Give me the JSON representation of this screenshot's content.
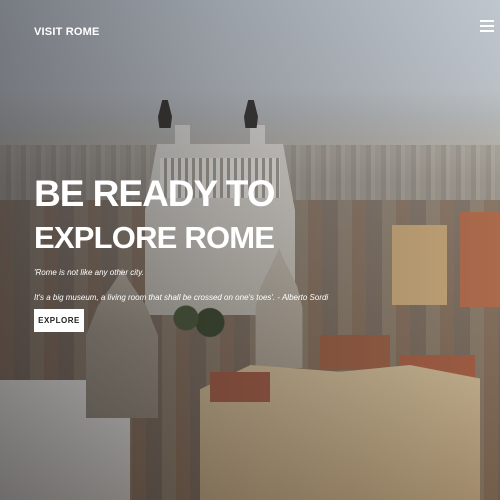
{
  "header": {
    "brand": "VISIT ROME",
    "menu_icon": "hamburger-menu-icon"
  },
  "hero": {
    "title_line1": "BE READY TO",
    "title_line2": "EXPLORE ROME",
    "quote_line1": "'Rome is not like any other city.",
    "quote_line2": "It's a big museum, a living room that shall be crossed on one's toes'. - Alberto Sordi",
    "cta_label": "EXPLORE"
  }
}
